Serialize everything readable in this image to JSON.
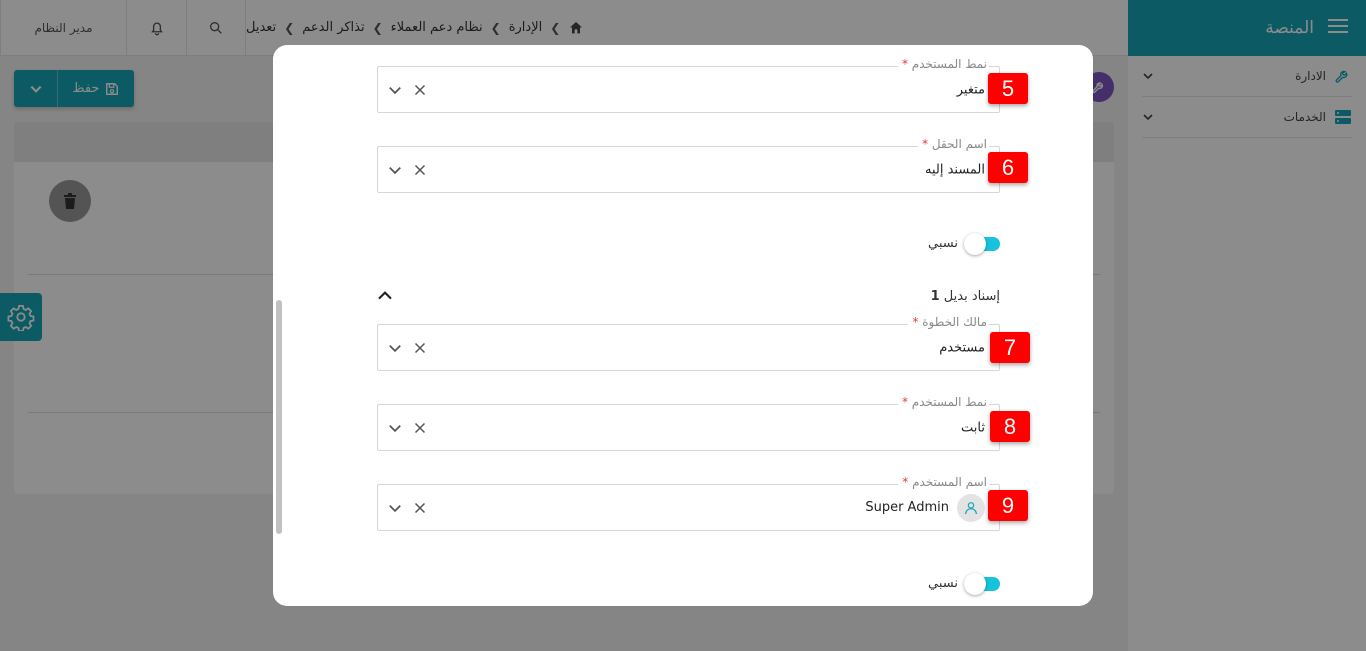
{
  "sidebar": {
    "brand": "المنصة",
    "items": [
      {
        "label": "الادارة",
        "icon": "wrench-icon"
      },
      {
        "label": "الخدمات",
        "icon": "server-icon"
      }
    ]
  },
  "topbar": {
    "user": "مدير النظام",
    "breadcrumb": [
      "الإدارة",
      "نظام دعم العملاء",
      "تذاكر الدعم",
      "تعديل"
    ]
  },
  "toolbar": {
    "save_label": "حفظ"
  },
  "modal": {
    "fields": [
      {
        "badge": "5",
        "label": "نمط المستخدم",
        "value": "متغير"
      },
      {
        "badge": "6",
        "label": "اسم الحقل",
        "value": "المسند إليه"
      },
      {
        "badge": "7",
        "label": "مالك الخطوة",
        "value": "مستخدم"
      },
      {
        "badge": "8",
        "label": "نمط المستخدم",
        "value": "ثابت"
      },
      {
        "badge": "9",
        "label": "اسم المستخدم",
        "value": "Super Admin"
      }
    ],
    "required_mark": "*",
    "toggle_label": "نسبي",
    "section_title": "إسناد بديل",
    "section_number": "1"
  },
  "colors": {
    "accent": "#17a7b7",
    "badge": "#ff0000",
    "switch": "#17c3dc",
    "required": "#e53935"
  }
}
